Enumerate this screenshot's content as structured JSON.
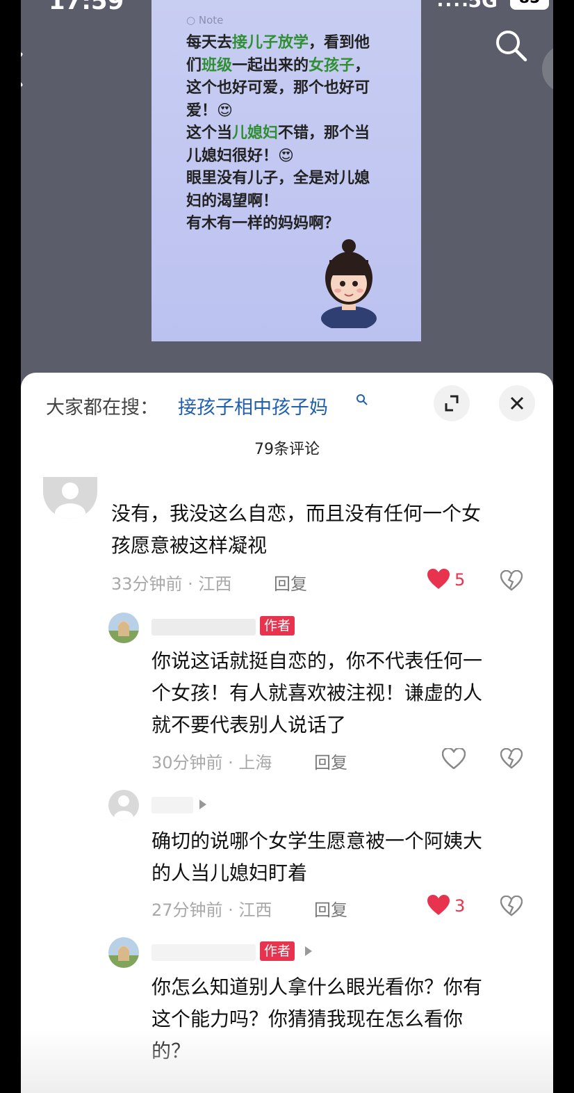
{
  "status_bar": {
    "time": "17:59",
    "signal": "....",
    "network": "5G",
    "battery": "85"
  },
  "note": {
    "tag": "Note",
    "lines": [
      [
        "每天去",
        {
          "h": "接儿子放学"
        },
        "，看到他"
      ],
      [
        "们",
        {
          "h": "班级"
        },
        "一起出来的",
        {
          "h": "女孩子"
        },
        "，"
      ],
      [
        "这个也好可爱，那个也好可"
      ],
      [
        "爱！😍"
      ],
      [
        "这个当",
        {
          "h": "儿媳妇"
        },
        "不错，那个当"
      ],
      [
        "儿媳妇很好！😍"
      ],
      [
        "眼里没有儿子，全是对儿媳"
      ],
      [
        "妇的渴望啊！"
      ],
      [
        "有木有一样的妈妈啊？"
      ]
    ]
  },
  "sheet": {
    "search_prefix": "大家都在搜：",
    "search_query": "接孩子相中孩子妈",
    "comment_count": "79条评论"
  },
  "comments": [
    {
      "text_lines": [
        "没有，我没这么自恋，而且没有任何一个女",
        "孩愿意被这样凝视"
      ],
      "meta": "33分钟前 · 江西",
      "reply": "回复",
      "likes": "5",
      "liked": true
    },
    {
      "badge": "作者",
      "text_lines": [
        "你说这话就挺自恋的，你不代表任何一",
        "个女孩！有人就喜欢被注视！谦虚的人",
        "就不要代表别人说话了"
      ],
      "meta": "30分钟前 · 上海",
      "reply": "回复",
      "likes": "",
      "liked": false
    },
    {
      "text_lines": [
        "确切的说哪个女学生愿意被一个阿姨大",
        "的人当儿媳妇盯着"
      ],
      "meta": "27分钟前 · 江西",
      "reply": "回复",
      "likes": "3",
      "liked": true
    },
    {
      "badge": "作者",
      "text_lines": [
        "你怎么知道别人拿什么眼光看你？你有",
        "这个能力吗？你猜猜我现在怎么看你",
        "的？"
      ],
      "meta": "",
      "reply": "",
      "likes": "",
      "liked": false
    }
  ],
  "colors": {
    "sheet_bg": "#ffffff",
    "note_bg": "#c3c8f1",
    "highlight": "#2f8f32",
    "like_red": "#e8334e",
    "link_blue": "#1f5fae"
  },
  "icons": [
    "back-arrow-icon",
    "search-icon",
    "scan-icon",
    "expand-icon",
    "close-icon",
    "heart-icon",
    "dislike-icon",
    "search-small-icon"
  ]
}
